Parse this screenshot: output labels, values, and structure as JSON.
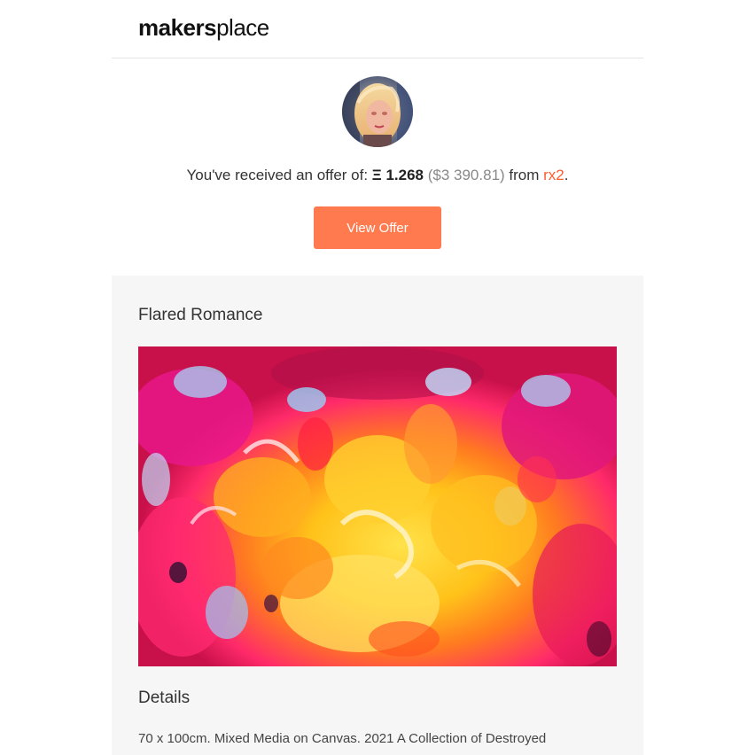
{
  "brand": {
    "logo_bold": "makers",
    "logo_light": "place"
  },
  "offer": {
    "prefix": "You've received an offer of: ",
    "amount": "Ξ 1.268",
    "usd": "($3 390.81)",
    "from_text": " from ",
    "user": "rx2",
    "suffix": "."
  },
  "buttons": {
    "view_offer": "View Offer"
  },
  "artwork": {
    "title": "Flared Romance",
    "details_heading": "Details",
    "details_text": "70 x 100cm. Mixed Media on Canvas. 2021 A Collection of Destroyed"
  },
  "colors": {
    "accent": "#ff7a4f",
    "link": "#ff5b2e",
    "card_bg": "#f6f6f6"
  }
}
